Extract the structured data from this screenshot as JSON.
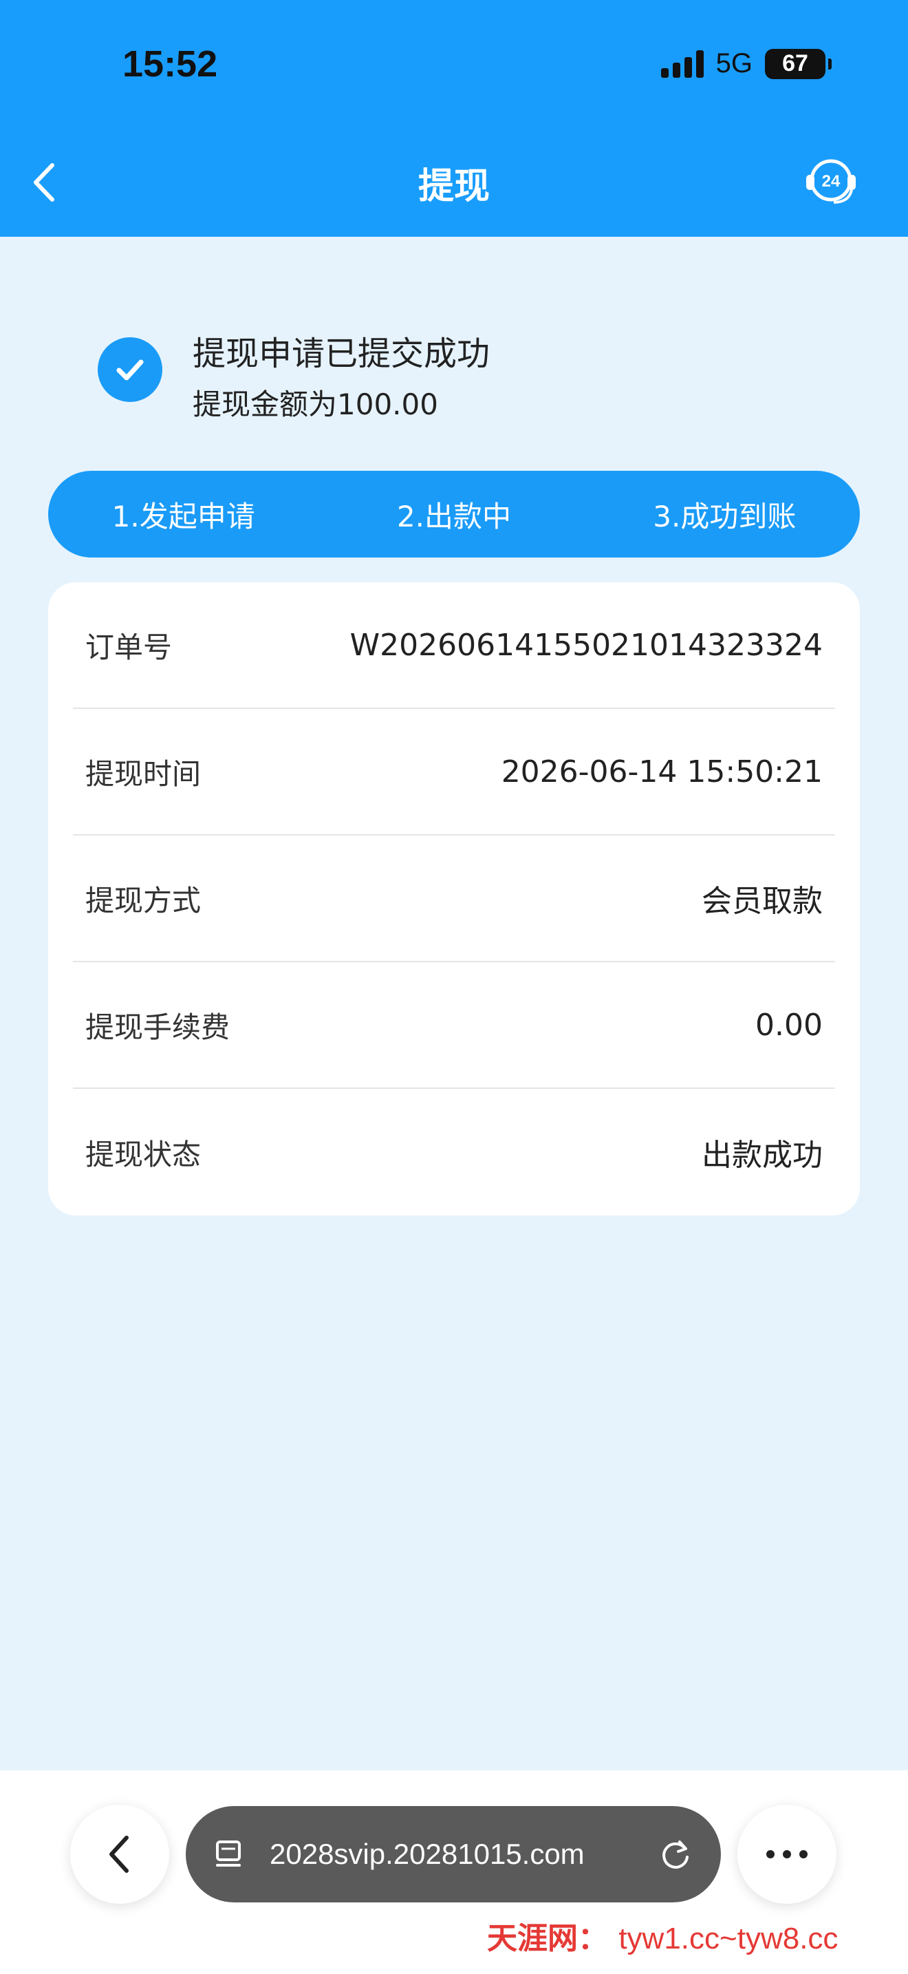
{
  "status_bar": {
    "time": "15:52",
    "network": "5G",
    "battery": "67"
  },
  "nav": {
    "title": "提现",
    "support_badge": "24"
  },
  "result": {
    "title": "提现申请已提交成功",
    "amount_text": "提现金额为100.00"
  },
  "steps": [
    {
      "label": "1.发起申请"
    },
    {
      "label": "2.出款中"
    },
    {
      "label": "3.成功到账"
    }
  ],
  "details": [
    {
      "label": "订单号",
      "value": "W2026061415502101432332​4"
    },
    {
      "label": "提现时间",
      "value": "2026-06-14 15:50:21"
    },
    {
      "label": "提现方式",
      "value": "会员取款"
    },
    {
      "label": "提现手续费",
      "value": "0.00"
    },
    {
      "label": "提现状态",
      "value": "出款成功"
    }
  ],
  "browser": {
    "url": "2028svip.20281015.com"
  },
  "watermark": {
    "brand": "天涯网：",
    "url": "tyw1.cc~tyw8.cc"
  },
  "colors": {
    "header": "#199dfc",
    "accent": "#1a9bf8",
    "page_bg": "#e6f3fd"
  }
}
